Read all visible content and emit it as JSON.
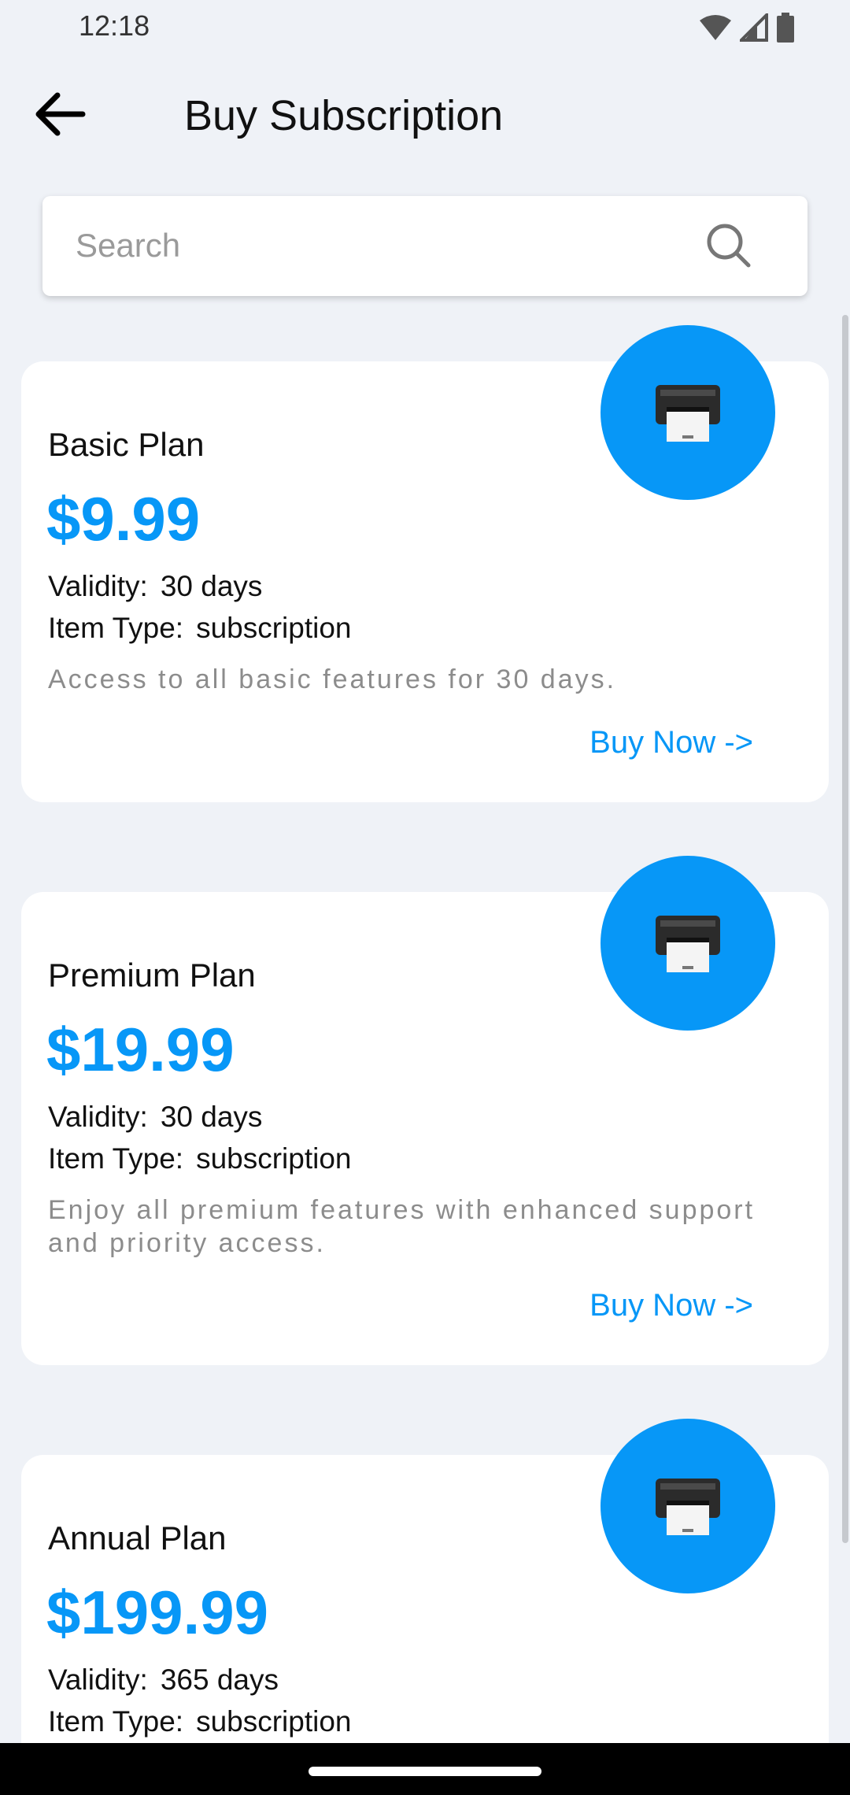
{
  "status_bar": {
    "time": "12:18",
    "icons": [
      "wifi-icon",
      "signal-icon",
      "battery-icon"
    ]
  },
  "header": {
    "back_icon": "arrow-left-icon",
    "title": "Buy Subscription"
  },
  "search": {
    "placeholder": "Search",
    "value": "",
    "icon": "search-icon"
  },
  "labels": {
    "validity": "Validity:",
    "item_type": "Item Type:"
  },
  "plans": [
    {
      "name": "Basic Plan",
      "price": "$9.99",
      "validity": "30 days",
      "item_type": "subscription",
      "description": "Access to all basic features for 30 days.",
      "button_label": "Buy Now ->",
      "icon": "printer-icon"
    },
    {
      "name": "Premium Plan",
      "price": "$19.99",
      "validity": "30 days",
      "item_type": "subscription",
      "description": "Enjoy all premium features with enhanced support and priority access.",
      "button_label": "Buy Now ->",
      "icon": "printer-icon"
    },
    {
      "name": "Annual Plan",
      "price": "$199.99",
      "validity": "365 days",
      "item_type": "subscription",
      "icon": "printer-icon"
    }
  ],
  "colors": {
    "accent": "#0797f7",
    "background": "#eff2f7",
    "card": "#ffffff",
    "muted_text": "#8c8c8c"
  }
}
